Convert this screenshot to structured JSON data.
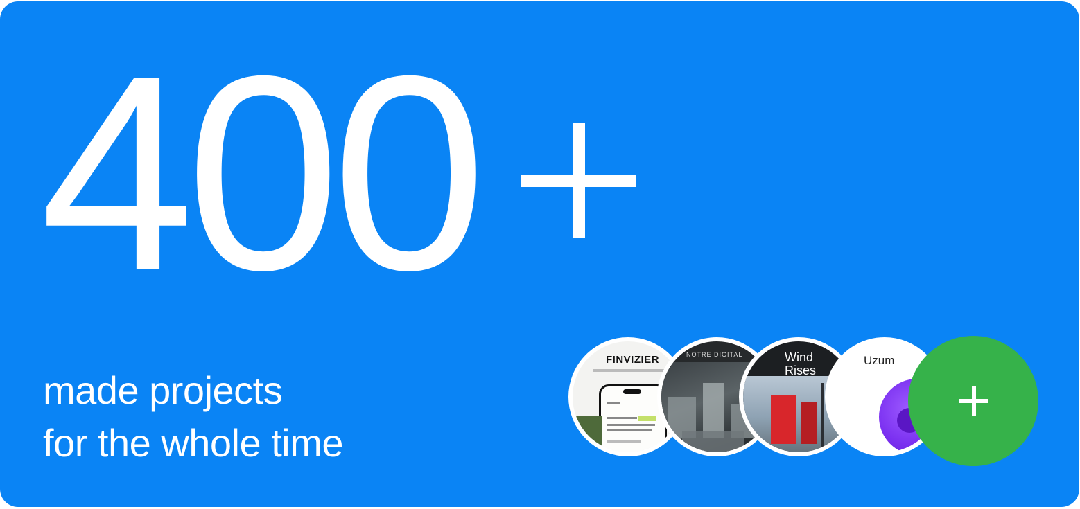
{
  "stat": {
    "number": "400",
    "suffix": "+",
    "caption_line1": "made projects",
    "caption_line2": "for the whole time"
  },
  "projects": [
    {
      "brand": "FINVIZIER",
      "icon": "project-thumbnail-finvizier"
    },
    {
      "brand": "NOTRE DIGITAL",
      "icon": "project-thumbnail-city"
    },
    {
      "brand": "Wind Rises",
      "icon": "project-thumbnail-wind-rises"
    },
    {
      "brand": "Uzum",
      "icon": "project-thumbnail-uzum"
    }
  ],
  "add_button": {
    "icon": "plus-icon"
  },
  "colors": {
    "card_background": "#0a84f5",
    "text": "#ffffff",
    "add_button": "#36b24a"
  }
}
